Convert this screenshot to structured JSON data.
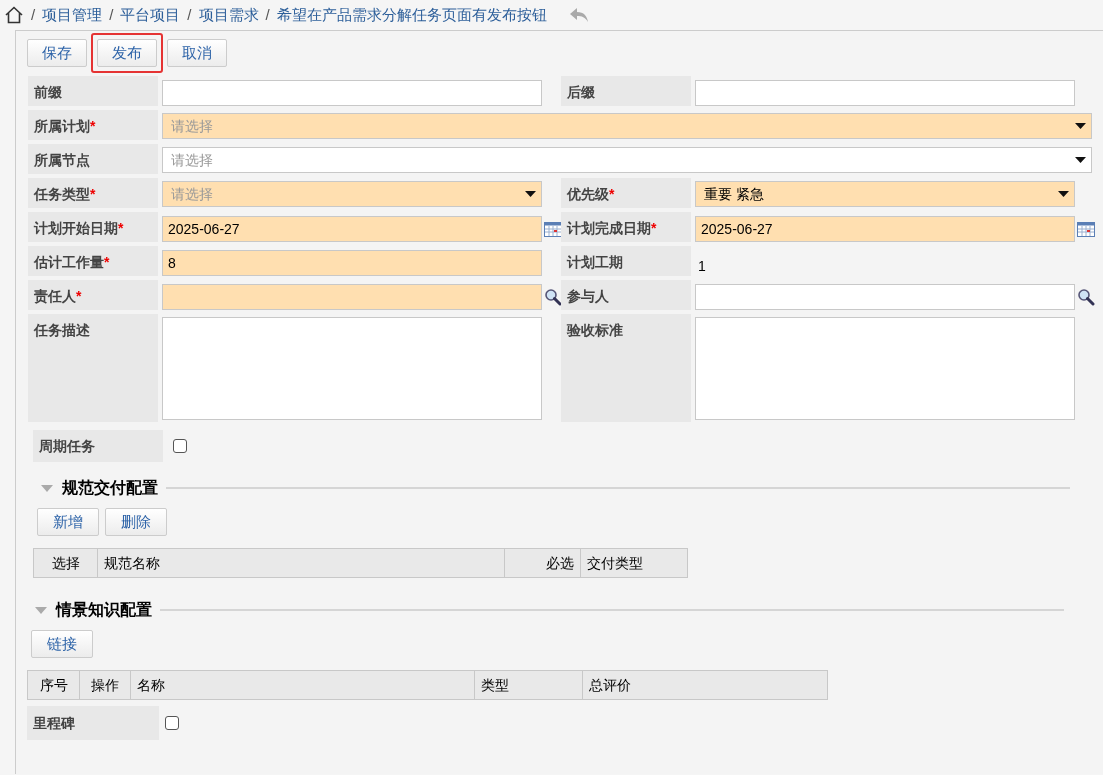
{
  "breadcrumb": [
    {
      "separator": "/",
      "label": "项目管理"
    },
    {
      "separator": "/",
      "label": "平台项目"
    },
    {
      "separator": "/",
      "label": "项目需求"
    },
    {
      "separator": "/",
      "label": "希望在产品需求分解任务页面有发布按钮"
    }
  ],
  "toolbar": [
    {
      "label": "保存",
      "highlighted": false
    },
    {
      "label": "发布",
      "highlighted": true
    },
    {
      "label": "取消",
      "highlighted": false
    }
  ],
  "form_rows": [
    [
      {
        "label": "前缀",
        "kind": "text"
      },
      {
        "label": "后缀",
        "kind": "text"
      }
    ],
    [
      {
        "label": "所属计划",
        "required_mark": "*",
        "kind": "select",
        "wide": true,
        "placeholder": "请选择"
      }
    ],
    [
      {
        "label": "所属节点",
        "kind": "select",
        "wide": true,
        "placeholder": "请选择"
      }
    ],
    [
      {
        "label": "任务类型",
        "required_mark": "*",
        "kind": "select",
        "placeholder": "请选择"
      },
      {
        "label": "优先级",
        "required_mark": "*",
        "kind": "select",
        "value": "重要 紧急"
      }
    ],
    [
      {
        "label": "计划开始日期",
        "required_mark": "*",
        "kind": "date",
        "value": "2025-06-27"
      },
      {
        "label": "计划完成日期",
        "required_mark": "*",
        "kind": "date",
        "value": "2025-06-27"
      }
    ],
    [
      {
        "label": "估计工作量",
        "required_mark": "*",
        "kind": "text",
        "value": "8"
      },
      {
        "label": "计划工期",
        "kind": "readonly",
        "value": "1"
      }
    ],
    [
      {
        "label": "责任人",
        "required_mark": "*",
        "kind": "lookup"
      },
      {
        "label": "参与人",
        "kind": "lookup"
      }
    ],
    [
      {
        "label": "任务描述",
        "kind": "textarea"
      },
      {
        "label": "验收标准",
        "kind": "textarea"
      }
    ]
  ],
  "periodic_task": {
    "label": "周期任务",
    "checked": false
  },
  "sections": [
    {
      "title": "规范交付配置",
      "expanded": true,
      "buttons": [
        "新增",
        "删除"
      ],
      "columns": [
        "选择",
        "规范名称",
        "必选",
        "交付类型"
      ]
    },
    {
      "title": "情景知识配置",
      "expanded": true,
      "buttons": [
        "链接"
      ],
      "columns": [
        "序号",
        "操作",
        "名称",
        "类型",
        "总评价"
      ]
    }
  ],
  "milestone": {
    "label": "里程碑",
    "checked": false
  }
}
